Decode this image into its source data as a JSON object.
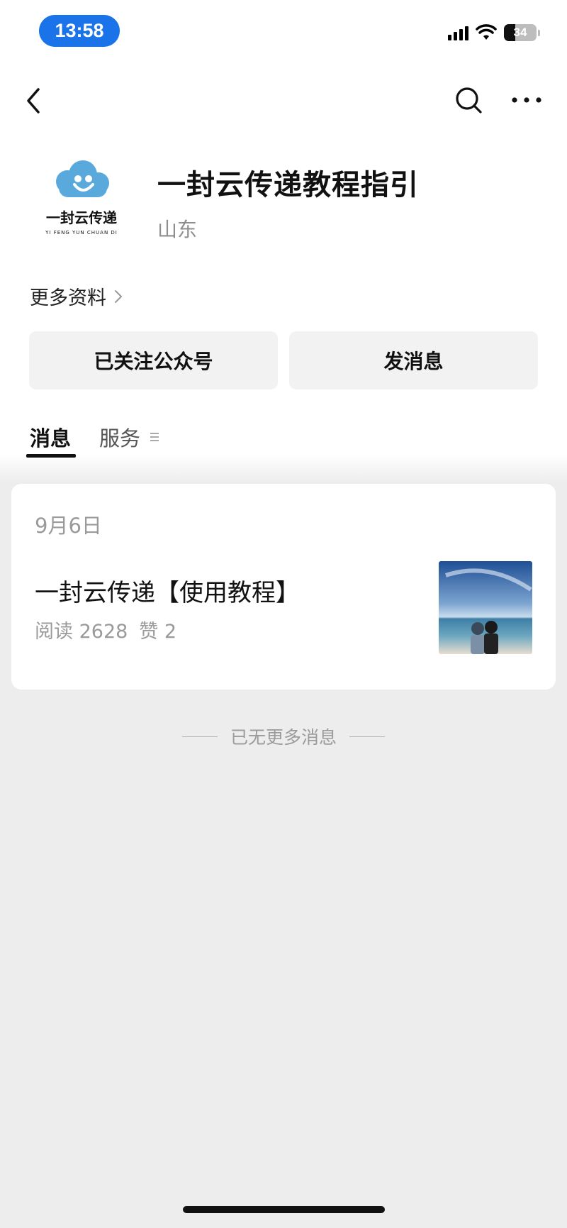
{
  "status_bar": {
    "time": "13:58",
    "battery": "34",
    "battery_level": 0.34
  },
  "nav": {
    "back_icon": "chevron-left-icon",
    "search_icon": "search-icon",
    "more_icon": "more-dots-icon"
  },
  "profile": {
    "logo_text": "一封云传递",
    "logo_subtext": "YI FENG YUN CHUAN DI",
    "name": "一封云传递教程指引",
    "region": "山东",
    "more_info": "更多资料"
  },
  "actions": {
    "follow": "已关注公众号",
    "message": "发消息"
  },
  "tabs": {
    "messages": "消息",
    "services": "服务"
  },
  "feed": {
    "date": "9月6日",
    "article": {
      "title": "一封云传递【使用教程】",
      "reads": "阅读 2628",
      "likes": "赞 2"
    }
  },
  "end_text": "已无更多消息",
  "colors": {
    "accent": "#1a73e8",
    "logo_blue": "#5aa9dc",
    "background": "#ededed"
  }
}
